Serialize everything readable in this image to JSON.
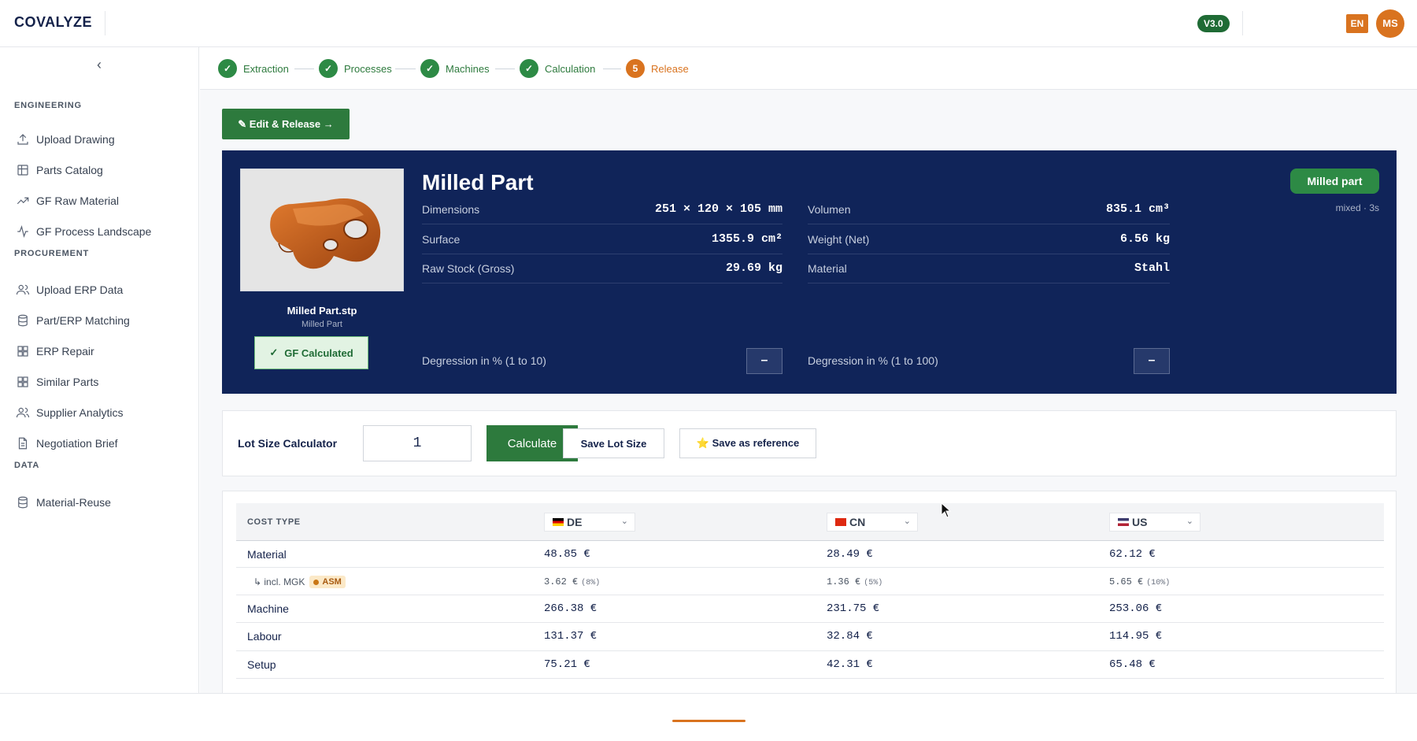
{
  "app": {
    "logo": "COVALYZE",
    "version": "V3.0",
    "language": "EN",
    "user_initials": "MS"
  },
  "sidebar": {
    "sections": [
      {
        "title": "ENGINEERING",
        "items": [
          {
            "label": "Upload Drawing",
            "icon": "upload-icon"
          },
          {
            "label": "Parts Catalog",
            "icon": "table-icon"
          },
          {
            "label": "GF Raw Material",
            "icon": "trending-icon"
          },
          {
            "label": "GF Process Landscape",
            "icon": "activity-icon"
          }
        ]
      },
      {
        "title": "PROCUREMENT",
        "items": [
          {
            "label": "Upload ERP Data",
            "icon": "users-icon"
          },
          {
            "label": "Part/ERP Matching",
            "icon": "database-icon"
          },
          {
            "label": "ERP Repair",
            "icon": "grid-icon"
          },
          {
            "label": "Similar Parts",
            "icon": "grid-icon"
          },
          {
            "label": "Supplier Analytics",
            "icon": "users-icon"
          },
          {
            "label": "Negotiation Brief",
            "icon": "document-icon"
          }
        ]
      },
      {
        "title": "DATA",
        "items": [
          {
            "label": "Material-Reuse",
            "icon": "database-icon"
          }
        ]
      }
    ]
  },
  "stepper": [
    {
      "label": "Extraction",
      "state": "done",
      "mark": "✓"
    },
    {
      "label": "Processes",
      "state": "done",
      "mark": "✓"
    },
    {
      "label": "Machines",
      "state": "done",
      "mark": "✓"
    },
    {
      "label": "Calculation",
      "state": "done",
      "mark": "✓"
    },
    {
      "label": "Release",
      "state": "active",
      "mark": "5"
    }
  ],
  "edit_button": "✎ Edit & Release →",
  "part": {
    "title": "Milled Part",
    "file_name": "Milled Part.stp",
    "file_sub": "Milled Part",
    "gf_status": "GF Calculated",
    "type_badge": "Milled part",
    "type_sub": "mixed · 3s",
    "props_left": [
      {
        "label": "Dimensions",
        "value": "251 × 120 × 105 mm"
      },
      {
        "label": "Surface",
        "value": "1355.9 cm²"
      },
      {
        "label": "Raw Stock (Gross)",
        "value": "29.69 kg"
      }
    ],
    "props_right": [
      {
        "label": "Volumen",
        "value": "835.1 cm³"
      },
      {
        "label": "Weight (Net)",
        "value": "6.56 kg"
      },
      {
        "label": "Material",
        "value": "Stahl"
      }
    ],
    "degression_left": {
      "label": "Degression in % (1 to 10)",
      "value": "–"
    },
    "degression_right": {
      "label": "Degression in % (1 to 100)",
      "value": "–"
    }
  },
  "lot": {
    "label": "Lot Size Calculator",
    "value": "1",
    "calculate": "Calculate",
    "save_lot": "Save Lot Size",
    "save_ref": "⭐ Save as reference"
  },
  "cost_table": {
    "header": "COST TYPE",
    "countries": [
      {
        "code": "DE",
        "flag_colors": [
          "#000000",
          "#dd0000",
          "#ffce00"
        ]
      },
      {
        "code": "CN",
        "flag_colors": [
          "#de2910",
          "#de2910",
          "#de2910"
        ]
      },
      {
        "code": "US",
        "flag_colors": [
          "#3c3b6e",
          "#ffffff",
          "#b22234"
        ]
      }
    ],
    "rows": [
      {
        "name": "Material",
        "values": [
          "48.85 €",
          "28.49 €",
          "62.12 €"
        ]
      },
      {
        "name": "↳ incl. MGK",
        "badge": "ASM",
        "sub": true,
        "values": [
          "3.62 €",
          "1.36 €",
          "5.65 €"
        ],
        "pcts": [
          "(8%)",
          "(5%)",
          "(10%)"
        ]
      },
      {
        "name": "Machine",
        "values": [
          "266.38 €",
          "231.75 €",
          "253.06 €"
        ]
      },
      {
        "name": "Labour",
        "values": [
          "131.37 €",
          "32.84 €",
          "114.95 €"
        ]
      },
      {
        "name": "Setup",
        "values": [
          "75.21 €",
          "42.31 €",
          "65.48 €"
        ]
      }
    ]
  }
}
